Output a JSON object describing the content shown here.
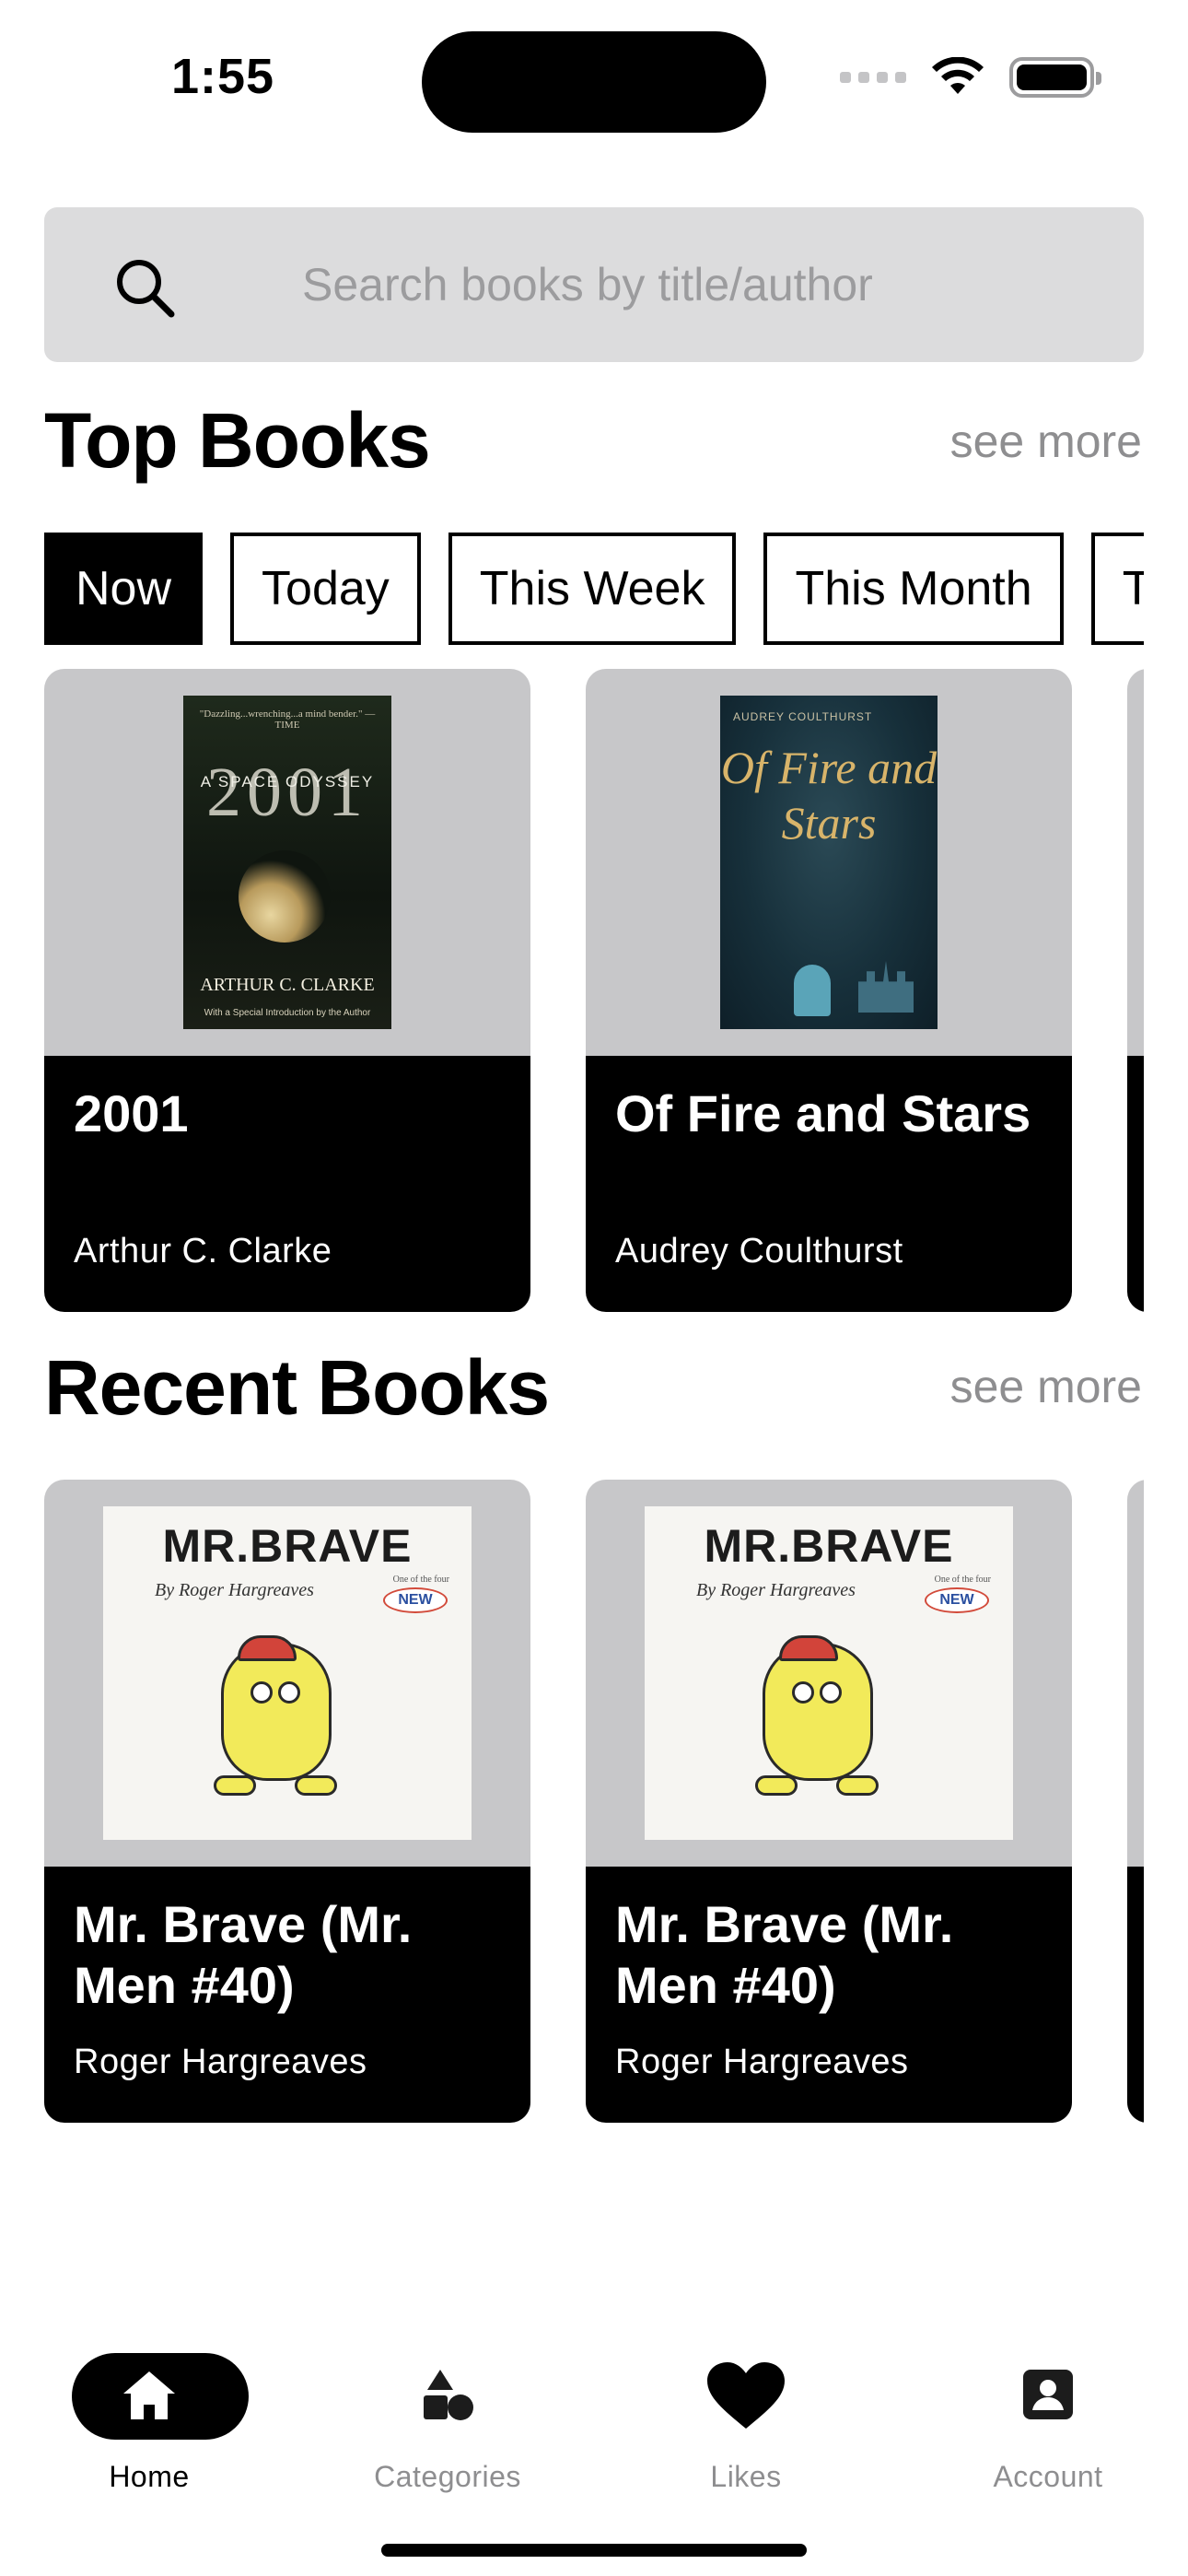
{
  "status_bar": {
    "time": "1:55",
    "battery_level": 1.0
  },
  "search": {
    "placeholder": "Search books by title/author",
    "value": ""
  },
  "top_books": {
    "title": "Top Books",
    "see_more": "see more",
    "filters": [
      "Now",
      "Today",
      "This Week",
      "This Month",
      "This Year"
    ],
    "active_filter": "Now",
    "books": [
      {
        "title": "2001",
        "author": "Arthur C. Clarke",
        "cover": {
          "quote": "\"Dazzling...wrenching...a mind bender.\" —TIME",
          "big": "2001",
          "subtitle": "A SPACE ODYSSEY",
          "author": "ARTHUR C. CLARKE",
          "note": "With a Special Introduction by the Author"
        }
      },
      {
        "title": "Of Fire and Stars",
        "author": "Audrey Coulthurst",
        "cover": {
          "author": "AUDREY COULTHURST",
          "script": "Of Fire and Stars"
        }
      }
    ]
  },
  "recent_books": {
    "title": "Recent Books",
    "see_more": "see more",
    "books": [
      {
        "title": "Mr. Brave (Mr. Men #40)",
        "author": "Roger Hargreaves",
        "cover": {
          "title": "MR.BRAVE",
          "by": "By Roger Hargreaves",
          "badge_note": "One of the four",
          "badge": "NEW"
        }
      },
      {
        "title": "Mr. Brave (Mr. Men #40)",
        "author": "Roger Hargreaves",
        "cover": {
          "title": "MR.BRAVE",
          "by": "By Roger Hargreaves",
          "badge_note": "One of the four",
          "badge": "NEW"
        }
      }
    ]
  },
  "bottom_nav": {
    "items": [
      {
        "label": "Home",
        "icon": "home-icon",
        "active": true
      },
      {
        "label": "Categories",
        "icon": "shapes-icon",
        "active": false
      },
      {
        "label": "Likes",
        "icon": "heart-icon",
        "active": false
      },
      {
        "label": "Account",
        "icon": "account-icon",
        "active": false
      }
    ]
  },
  "colors": {
    "accent": "#000000",
    "muted_text": "#8e8e90",
    "cover_bg": "#c7c7c9",
    "search_bg": "#dcdcdd"
  }
}
